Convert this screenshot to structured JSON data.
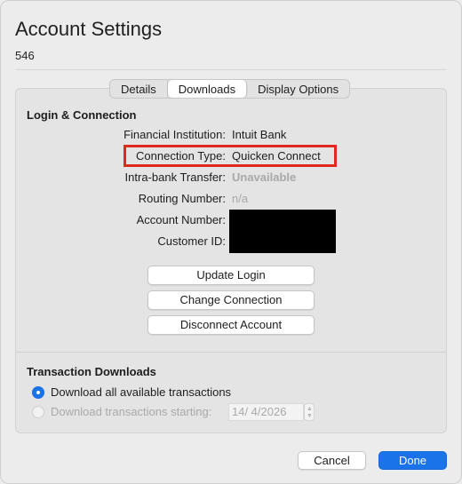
{
  "window": {
    "title": "Account Settings",
    "account_number": "546"
  },
  "tabs": [
    {
      "label": "Details",
      "active": false
    },
    {
      "label": "Downloads",
      "active": true
    },
    {
      "label": "Display Options",
      "active": false
    }
  ],
  "login_connection": {
    "heading": "Login & Connection",
    "fields": [
      {
        "label": "Financial Institution:",
        "value": "Intuit Bank"
      },
      {
        "label": "Connection Type:",
        "value": "Quicken Connect"
      },
      {
        "label": "Intra-bank Transfer:",
        "value": "Unavailable"
      },
      {
        "label": "Routing Number:",
        "value": "n/a"
      },
      {
        "label": "Account Number:",
        "value": ""
      },
      {
        "label": "Customer ID:",
        "value": ""
      }
    ],
    "buttons": {
      "update_login": "Update Login",
      "change_connection": "Change Connection",
      "disconnect_account": "Disconnect Account"
    }
  },
  "transaction_downloads": {
    "heading": "Transaction Downloads",
    "option_all": "Download all available transactions",
    "option_starting": "Download transactions starting:",
    "start_date": "14/  4/2026",
    "selected": "all"
  },
  "footer": {
    "cancel": "Cancel",
    "done": "Done"
  },
  "colors": {
    "accent": "#1a73e8",
    "highlight": "#e0281e",
    "redaction": "#000000"
  }
}
